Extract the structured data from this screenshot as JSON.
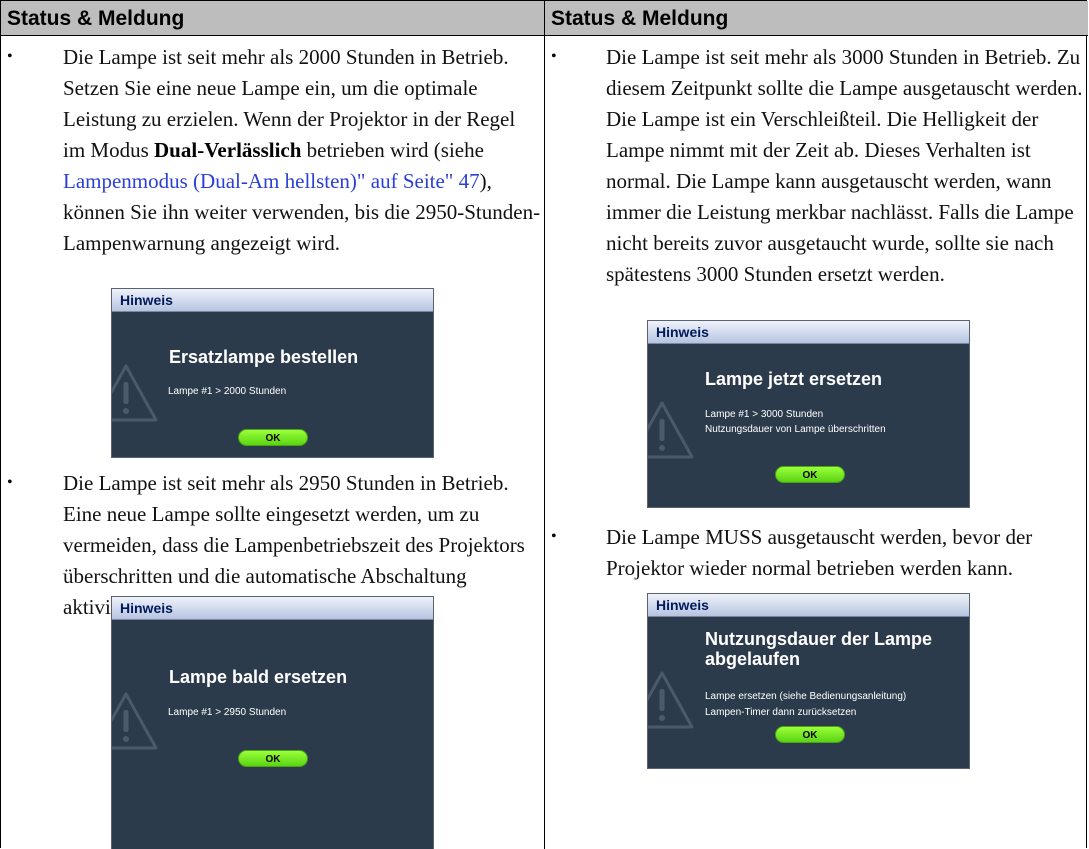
{
  "columns": [
    {
      "header": "Status & Meldung",
      "items": [
        {
          "bullet": "•",
          "text_a": "Die Lampe ist seit mehr als 2000 Stunden in Betrieb. Setzen Sie eine neue Lampe ein, um die optimale Leistung zu erzielen. Wenn der Projektor in der Regel im Modus ",
          "bold": "Dual-Verlässlich",
          "text_b": " betrieben wird (siehe ",
          "link": "Lampenmodus (Dual-Am hellsten)\" auf Seite\" 47",
          "text_c": "), können Sie ihn weiter verwenden, bis die 2950-Stunden-Lampenwarnung angezeigt wird.",
          "osd": {
            "bar": "Hinweis",
            "title": "Ersatzlampe bestellen",
            "lines": [
              "Lampe #1 > 2000 Stunden"
            ],
            "ok": "OK"
          }
        },
        {
          "bullet": "•",
          "text": "Die Lampe ist seit mehr als 2950 Stunden in Betrieb. Eine neue Lampe sollte eingesetzt werden, um zu vermeiden, dass die Lampenbetriebszeit des Projektors überschritten und die automatische Abschaltung aktiviert wird.",
          "osd": {
            "bar": "Hinweis",
            "title": "Lampe bald ersetzen",
            "lines": [
              "Lampe #1 > 2950 Stunden"
            ],
            "ok": "OK"
          }
        }
      ]
    },
    {
      "header": "Status & Meldung",
      "items": [
        {
          "bullet": "•",
          "text": "Die Lampe ist seit mehr als 3000 Stunden in Betrieb. Zu diesem Zeitpunkt sollte die Lampe ausgetauscht werden. Die Lampe ist ein Verschleißteil. Die Helligkeit der Lampe nimmt mit der Zeit ab. Dieses Verhalten ist normal. Die Lampe kann ausgetauscht werden, wann immer die Leistung merkbar nachlässt. Falls die Lampe nicht bereits zuvor ausgetaucht wurde, sollte sie nach spätestens 3000 Stunden ersetzt werden.",
          "osd": {
            "bar": "Hinweis",
            "title": "Lampe jetzt ersetzen",
            "lines": [
              "Lampe #1 > 3000 Stunden",
              "Nutzungsdauer von Lampe überschritten"
            ],
            "ok": "OK"
          }
        },
        {
          "bullet": "•",
          "text": "Die Lampe MUSS ausgetauscht werden, bevor der Projektor wieder normal betrieben werden kann.",
          "osd": {
            "bar": "Hinweis",
            "title_1": "Nutzungsdauer der Lampe",
            "title_2": "abgelaufen",
            "lines": [
              "Lampe ersetzen (siehe Bedienungsanleitung)",
              "Lampen-Timer dann zurücksetzen"
            ],
            "ok": "OK"
          }
        }
      ]
    }
  ],
  "colors": {
    "header_bg": "#bdbdbd",
    "osd_body": "#2c3b4c",
    "osd_ok": "#7ae82a",
    "link": "#2a3fd6"
  },
  "icons": [
    "warning-triangle-icon"
  ]
}
